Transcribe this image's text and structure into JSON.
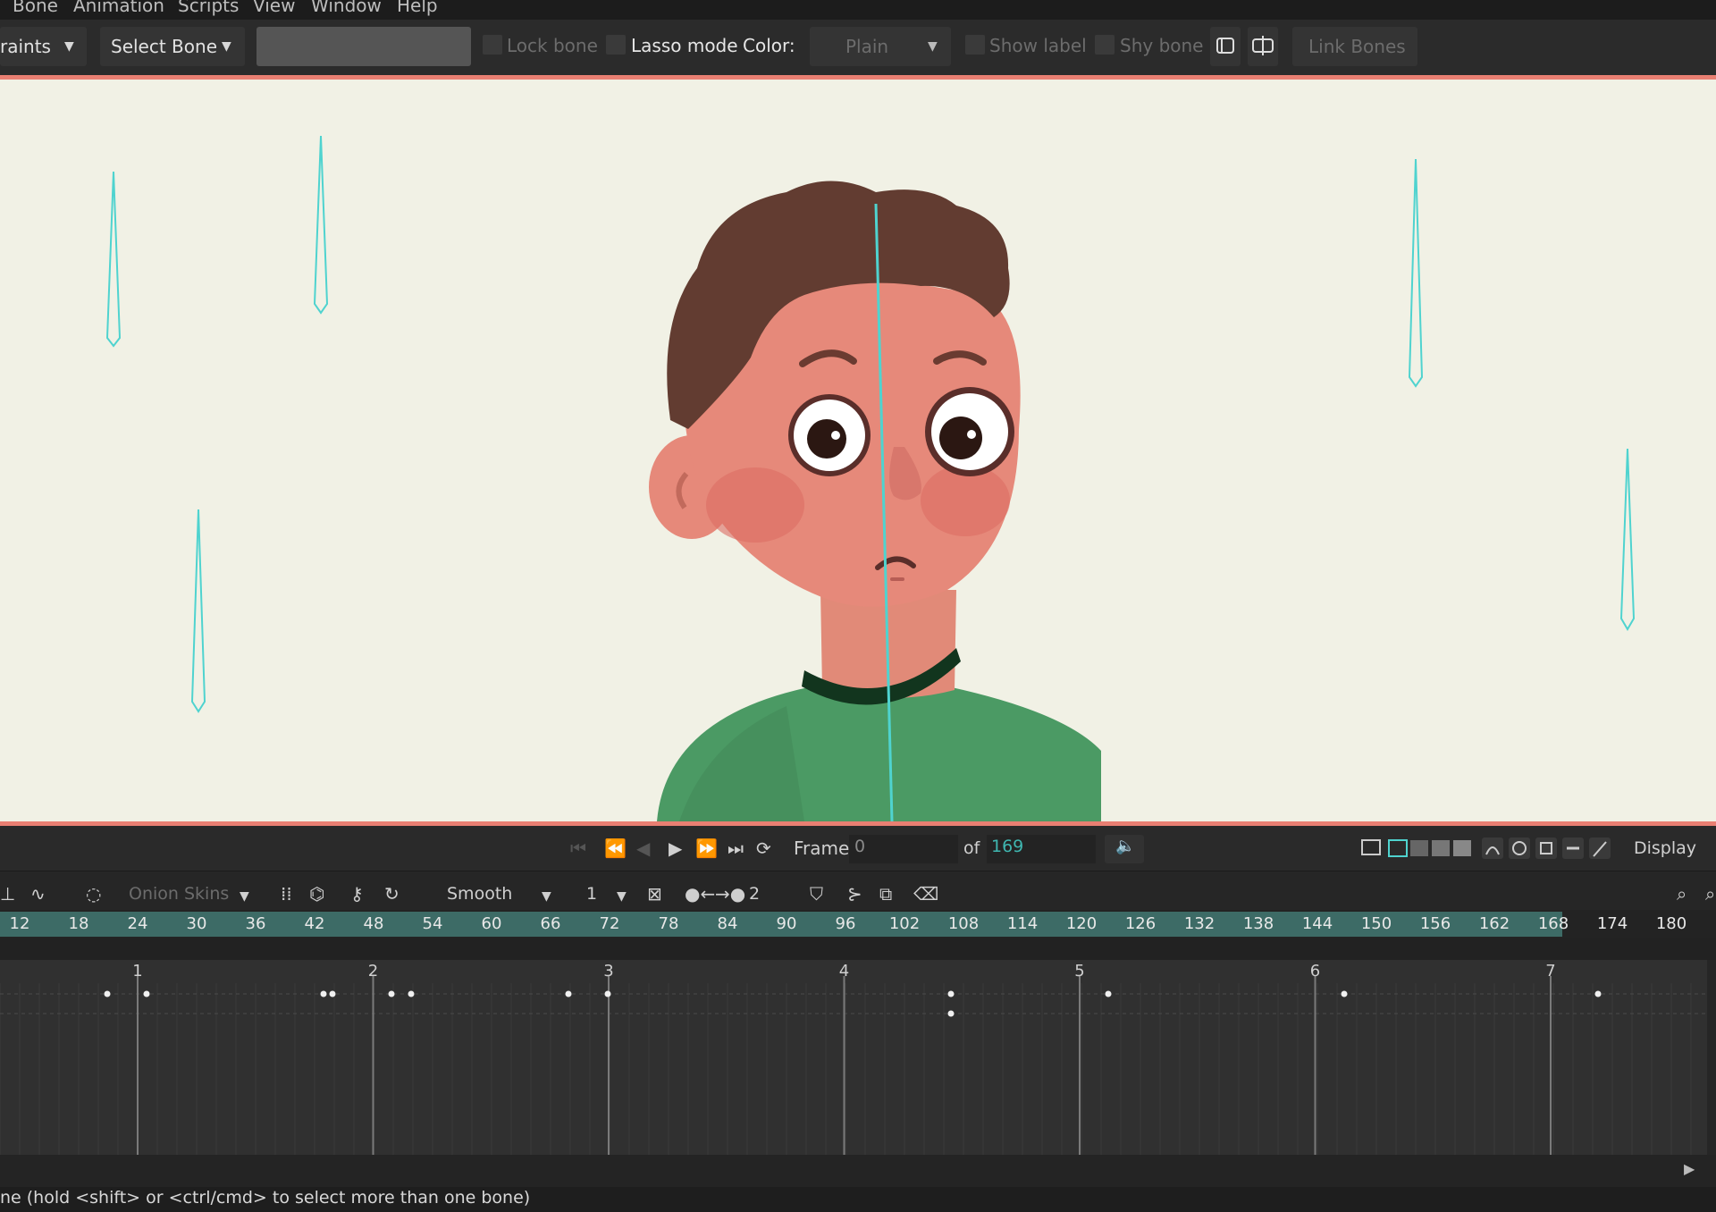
{
  "menu": {
    "items": [
      "Bone",
      "Animation",
      "Scripts",
      "View",
      "Window",
      "Help"
    ]
  },
  "toolbar": {
    "constraints_label": "raints",
    "select_bone_label": "Select Bone",
    "bone_name_value": "",
    "lock_bone_label": "Lock bone",
    "lasso_mode_label": "Lasso mode",
    "color_label": "Color:",
    "color_value": "Plain",
    "show_label_label": "Show label",
    "shy_bone_label": "Shy bone",
    "link_bones_label": "Link Bones"
  },
  "playback": {
    "frame_label": "Frame",
    "frame_value": "0",
    "of_label": "of",
    "total_frames": "169",
    "display_label": "Display"
  },
  "timeline_toolbar": {
    "onion_skins_label": "Onion Skins",
    "interpolation_value": "Smooth",
    "interp_number": "1",
    "keys_number": "2"
  },
  "ruler": {
    "ticks": [
      "12",
      "18",
      "24",
      "30",
      "36",
      "42",
      "48",
      "54",
      "60",
      "66",
      "72",
      "78",
      "84",
      "90",
      "96",
      "102",
      "108",
      "114",
      "120",
      "126",
      "132",
      "138",
      "144",
      "150",
      "156",
      "162",
      "168",
      "174",
      "180"
    ]
  },
  "tracks": {
    "second_markers": [
      "1",
      "2",
      "3",
      "4",
      "5",
      "6",
      "7"
    ]
  },
  "status": {
    "text": "ne (hold <shift> or <ctrl/cmd> to select more than one bone)"
  },
  "colors": {
    "accent": "#e97f72",
    "ruler_fill": "#3d6b66",
    "bone_cyan": "#4fd3cf",
    "canvas_bg": "#f1f1e5",
    "frame_total": "#3fb6b0"
  },
  "icons": {
    "canvas_tools": [
      "view-mode-icon",
      "single-view-icon",
      "split-view-icon",
      "quad-view-icon",
      "onion-toggle-icon"
    ]
  }
}
